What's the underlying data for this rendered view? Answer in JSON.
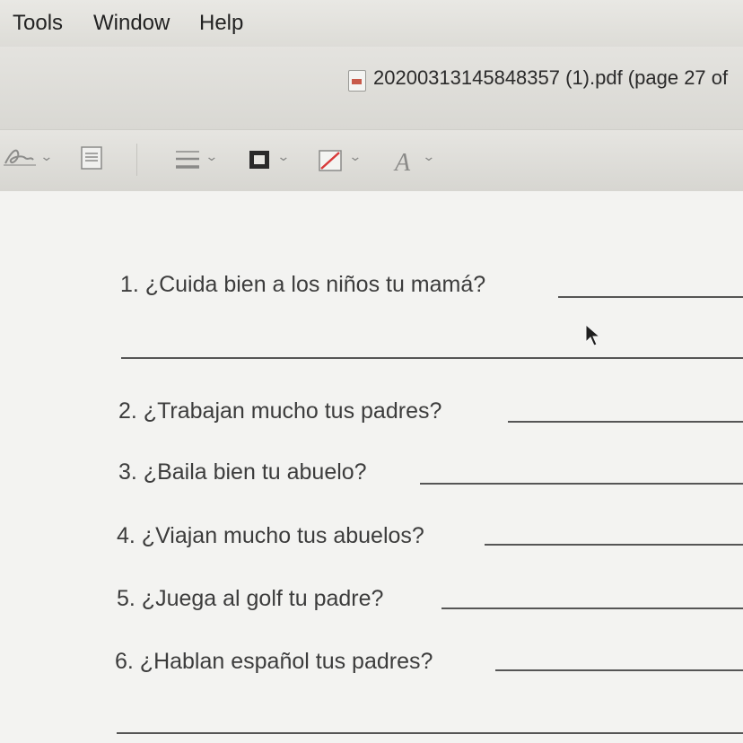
{
  "menubar": {
    "items": [
      "Tools",
      "Window",
      "Help"
    ]
  },
  "window": {
    "title": "20200313145848357 (1).pdf (page 27 of"
  },
  "toolbar": {
    "icons": [
      "signature-icon",
      "note-icon",
      "line-style-icon",
      "border-color-icon",
      "fill-color-icon",
      "text-style-icon"
    ],
    "text_style_glyph": "A"
  },
  "worksheet": {
    "questions": [
      "1. ¿Cuida bien a los niños tu mamá?",
      "2. ¿Trabajan mucho tus padres?",
      "3. ¿Baila bien tu abuelo?",
      "4. ¿Viajan mucho tus abuelos?",
      "5. ¿Juega al golf tu padre?",
      "6. ¿Hablan español tus padres?"
    ]
  }
}
